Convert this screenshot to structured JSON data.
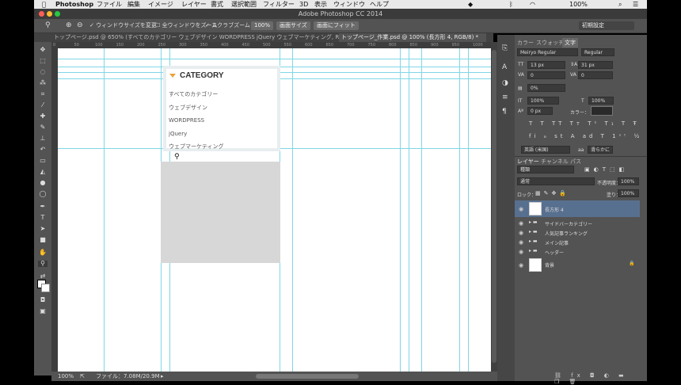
{
  "menubar": {
    "apple": "",
    "app_name": "Photoshop",
    "items": [
      "ファイル",
      "編集",
      "イメージ",
      "レイヤー",
      "書式",
      "選択範囲",
      "フィルター",
      "3D",
      "表示",
      "ウィンドウ",
      "ヘルプ"
    ],
    "battery": "100%"
  },
  "titlebar": {
    "title": "Adobe Photoshop CC 2014"
  },
  "options": {
    "resize_windows": "ウィンドウサイズを変更",
    "zoom_all": "全ウィンドウをズーム",
    "scrubby_zoom": "スクラブズーム",
    "zoom_100": "100%",
    "fit_screen": "画面サイズ",
    "fill_screen": "画面にフィット",
    "workspace": "初期設定"
  },
  "tabs": [
    "トップページ.psd @ 650% (すべてのカテゴリー ウェブデザイン WORDPRESS jQuery ウェブマーケティング, RGB/8) *",
    "トップページ_作業.psd @ 100% (長方形 4, RGB/8) *"
  ],
  "canvas": {
    "category_title": "CATEGORY",
    "category_items": [
      "すべてのカテゴリー",
      "ウェブデザイン",
      "WORDPRESS",
      "jQuery",
      "ウェブマーケティング"
    ],
    "accent_color": "#e8a33d"
  },
  "status": {
    "zoom": "100%",
    "file_info": "ファイル：7.08M/20.9M"
  },
  "character_panel": {
    "tabs": [
      "カラー",
      "スウォッチ",
      "文字"
    ],
    "font_family": "Meiryo Regular",
    "font_style": "Regular",
    "font_size": "13 px",
    "leading": "31 px",
    "kerning": "0",
    "tracking": "0",
    "tsume": "0%",
    "vscale": "100%",
    "hscale": "100%",
    "baseline": "0 px",
    "color_label": "カラー：",
    "language": "英語 (米国)",
    "aa_method": "滑らかに",
    "aa_label": "aa"
  },
  "layers_panel": {
    "tabs": [
      "レイヤー",
      "チャンネル",
      "パス"
    ],
    "filter_kind": "種類",
    "blend_mode": "通常",
    "opacity_label": "不透明度：",
    "opacity": "100%",
    "lock_label": "ロック：",
    "fill_label": "塗り：",
    "fill": "100%",
    "layers": [
      {
        "name": "長方形 4",
        "type": "shape",
        "selected": true
      },
      {
        "name": "サイドバーカテゴリー",
        "type": "group"
      },
      {
        "name": "人気記事ランキング",
        "type": "group"
      },
      {
        "name": "メイン記事",
        "type": "group"
      },
      {
        "name": "ヘッダー",
        "type": "group"
      },
      {
        "name": "背景",
        "type": "background",
        "locked": true
      }
    ]
  },
  "ruler_ticks": [
    "0",
    "50",
    "100",
    "150",
    "200",
    "250",
    "300",
    "350",
    "400",
    "450",
    "500",
    "550",
    "600",
    "650",
    "700",
    "750",
    "800",
    "850",
    "900",
    "950",
    "1000"
  ]
}
